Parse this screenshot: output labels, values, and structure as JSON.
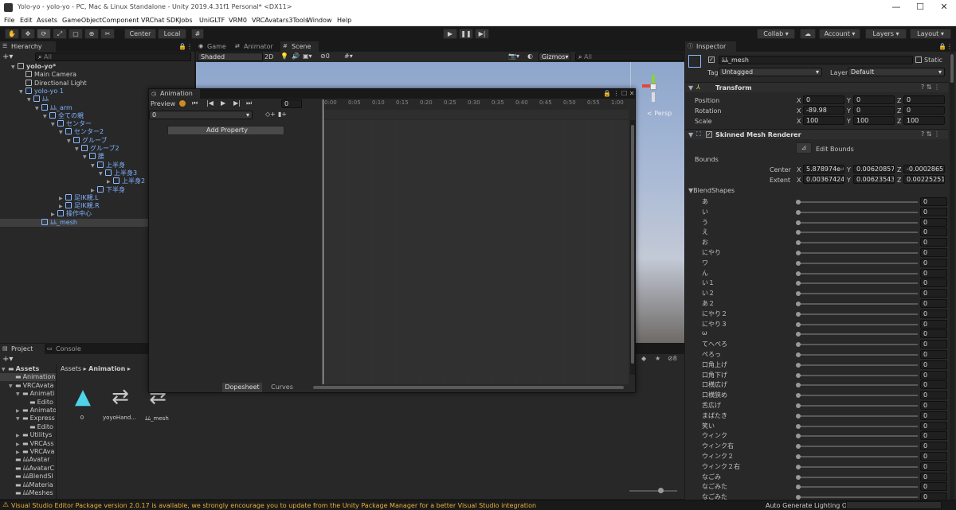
{
  "window": {
    "title": "Yolo-yo - yolo-yo - PC, Mac & Linux Standalone - Unity 2019.4.31f1 Personal* <DX11>",
    "minimize": "—",
    "maximize": "☐",
    "close": "✕"
  },
  "menu": [
    "File",
    "Edit",
    "Assets",
    "GameObject",
    "Component",
    "VRChat SDK",
    "Jobs",
    "UniGLTF",
    "VRM0",
    "VRCAvatars3Tools",
    "Window",
    "Help"
  ],
  "toolbar": {
    "pivot": "Center",
    "space": "Local",
    "collab": "Collab ▾",
    "account": "Account",
    "layers": "Layers",
    "layout": "Layout"
  },
  "hierarchy": {
    "tab": "Hierarchy",
    "search_placeholder": "All",
    "items": [
      {
        "label": "yolo-yo*",
        "depth": 0,
        "blue": false,
        "bold": true,
        "arrow": "▼"
      },
      {
        "label": "Main Camera",
        "depth": 1,
        "blue": false,
        "arrow": ""
      },
      {
        "label": "Directional Light",
        "depth": 1,
        "blue": false,
        "arrow": ""
      },
      {
        "label": "yolo-yo 1",
        "depth": 1,
        "blue": true,
        "arrow": "▼"
      },
      {
        "label": "ﾑﾑ",
        "depth": 2,
        "blue": true,
        "arrow": "▼"
      },
      {
        "label": "ﾑﾑ_arm",
        "depth": 3,
        "blue": true,
        "arrow": "▼"
      },
      {
        "label": "全ての親",
        "depth": 4,
        "blue": true,
        "arrow": "▼"
      },
      {
        "label": "センター",
        "depth": 5,
        "blue": true,
        "arrow": "▼"
      },
      {
        "label": "センター2",
        "depth": 6,
        "blue": true,
        "arrow": "▼"
      },
      {
        "label": "グルーブ",
        "depth": 7,
        "blue": true,
        "arrow": "▼"
      },
      {
        "label": "グルーブ2",
        "depth": 8,
        "blue": true,
        "arrow": "▼"
      },
      {
        "label": "腰",
        "depth": 9,
        "blue": true,
        "arrow": "▼"
      },
      {
        "label": "上半身",
        "depth": 10,
        "blue": true,
        "arrow": "▼"
      },
      {
        "label": "上半身3",
        "depth": 11,
        "blue": true,
        "arrow": "▼"
      },
      {
        "label": "上半身2",
        "depth": 12,
        "blue": true,
        "arrow": "▶"
      },
      {
        "label": "下半身",
        "depth": 10,
        "blue": true,
        "arrow": "▶"
      },
      {
        "label": "足IK親.L",
        "depth": 6,
        "blue": true,
        "arrow": "▶"
      },
      {
        "label": "足IK親.R",
        "depth": 6,
        "blue": true,
        "arrow": "▶"
      },
      {
        "label": "操作中心",
        "depth": 5,
        "blue": true,
        "arrow": "▶"
      },
      {
        "label": "ﾑﾑ_mesh",
        "depth": 3,
        "blue": true,
        "arrow": "",
        "selected": true
      }
    ]
  },
  "scene": {
    "tabs": [
      "Game",
      "Animator",
      "Scene"
    ],
    "shading": "Shaded",
    "mode2d": "2D",
    "hidden_count": "0",
    "gizmos": "Gizmos",
    "search_placeholder": "All",
    "persp": "< Persp"
  },
  "animation": {
    "tab": "Animation",
    "preview": "Preview",
    "frame": "0",
    "clip": "0",
    "add_property": "Add Property",
    "dopesheet": "Dopesheet",
    "curves": "Curves",
    "ticks": [
      "0:00",
      "0:05",
      "0:10",
      "0:15",
      "0:20",
      "0:25",
      "0:30",
      "0:35",
      "0:40",
      "0:45",
      "0:50",
      "0:55",
      "1:00"
    ]
  },
  "project": {
    "tabs": [
      "Project",
      "Console"
    ],
    "breadcrumb": [
      "Assets",
      "Animation"
    ],
    "hidden_count": "8",
    "tree": [
      {
        "label": "Assets",
        "depth": 0,
        "arrow": "▼",
        "bold": true
      },
      {
        "label": "Animation",
        "depth": 1,
        "arrow": "",
        "selected": true
      },
      {
        "label": "VRCAvata",
        "depth": 1,
        "arrow": "▼"
      },
      {
        "label": "Animati",
        "depth": 2,
        "arrow": "▼"
      },
      {
        "label": "Edito",
        "depth": 3,
        "arrow": ""
      },
      {
        "label": "Animato",
        "depth": 2,
        "arrow": "▶"
      },
      {
        "label": "Express",
        "depth": 2,
        "arrow": "▼"
      },
      {
        "label": "Edito",
        "depth": 3,
        "arrow": ""
      },
      {
        "label": "Utilitys",
        "depth": 2,
        "arrow": "▶"
      },
      {
        "label": "VRCAss",
        "depth": 2,
        "arrow": "▶"
      },
      {
        "label": "VRCAva",
        "depth": 2,
        "arrow": "▶"
      },
      {
        "label": "ﾑﾑAvatar",
        "depth": 1,
        "arrow": ""
      },
      {
        "label": "ﾑﾑAvatarC",
        "depth": 1,
        "arrow": ""
      },
      {
        "label": "ﾑﾑBlendSl",
        "depth": 1,
        "arrow": ""
      },
      {
        "label": "ﾑﾑMateria",
        "depth": 1,
        "arrow": ""
      },
      {
        "label": "ﾑﾑMeshes",
        "depth": 1,
        "arrow": ""
      }
    ],
    "assets": [
      {
        "label": "0",
        "icon": "animation-clip-icon"
      },
      {
        "label": "yoyoHand...",
        "icon": "animator-controller-icon"
      },
      {
        "label": "ﾑﾑ_mesh",
        "icon": "animator-controller-icon"
      }
    ]
  },
  "inspector": {
    "tab": "Inspector",
    "object_name": "ﾑﾑ_mesh",
    "static_label": "Static",
    "tag_label": "Tag",
    "tag_value": "Untagged",
    "layer_label": "Layer",
    "layer_value": "Default",
    "transform": {
      "title": "Transform",
      "position_label": "Position",
      "rotation_label": "Rotation",
      "scale_label": "Scale",
      "position": [
        "0",
        "0",
        "0"
      ],
      "rotation": [
        "-89.98",
        "0",
        "0"
      ],
      "scale": [
        "100",
        "100",
        "100"
      ]
    },
    "smr": {
      "title": "Skinned Mesh Renderer",
      "edit_bounds": "Edit Bounds",
      "bounds_label": "Bounds",
      "center_label": "Center",
      "extent_label": "Extent",
      "center": [
        "5.878974e-0",
        "0.006208578",
        "-0.00028657"
      ],
      "extent": [
        "0.003674249",
        "0.006235435",
        "0.002252513"
      ],
      "blendshapes_label": "BlendShapes",
      "blendshapes": [
        "あ",
        "い",
        "う",
        "え",
        "お",
        "にやり",
        "ワ",
        "ん",
        "い１",
        "い２",
        "あ２",
        "にやり２",
        "にやり３",
        "ω",
        "てへぺろ",
        "ぺろっ",
        "口角上げ",
        "口角下げ",
        "口横広げ",
        "口横狭め",
        "舌広げ",
        "まばたき",
        "笑い",
        "ウィンク",
        "ウィンク右",
        "ウィンク２",
        "ウィンク２右",
        "なごみ",
        "なごみた",
        "なごみた"
      ],
      "blendshape_value": "0"
    }
  },
  "status": {
    "warning": "Visual Studio Editor Package version 2.0.17 is available, we strongly encourage you to update from the Unity Package Manager for a better Visual Studio integration",
    "lighting": "Auto Generate Lighting Off"
  }
}
